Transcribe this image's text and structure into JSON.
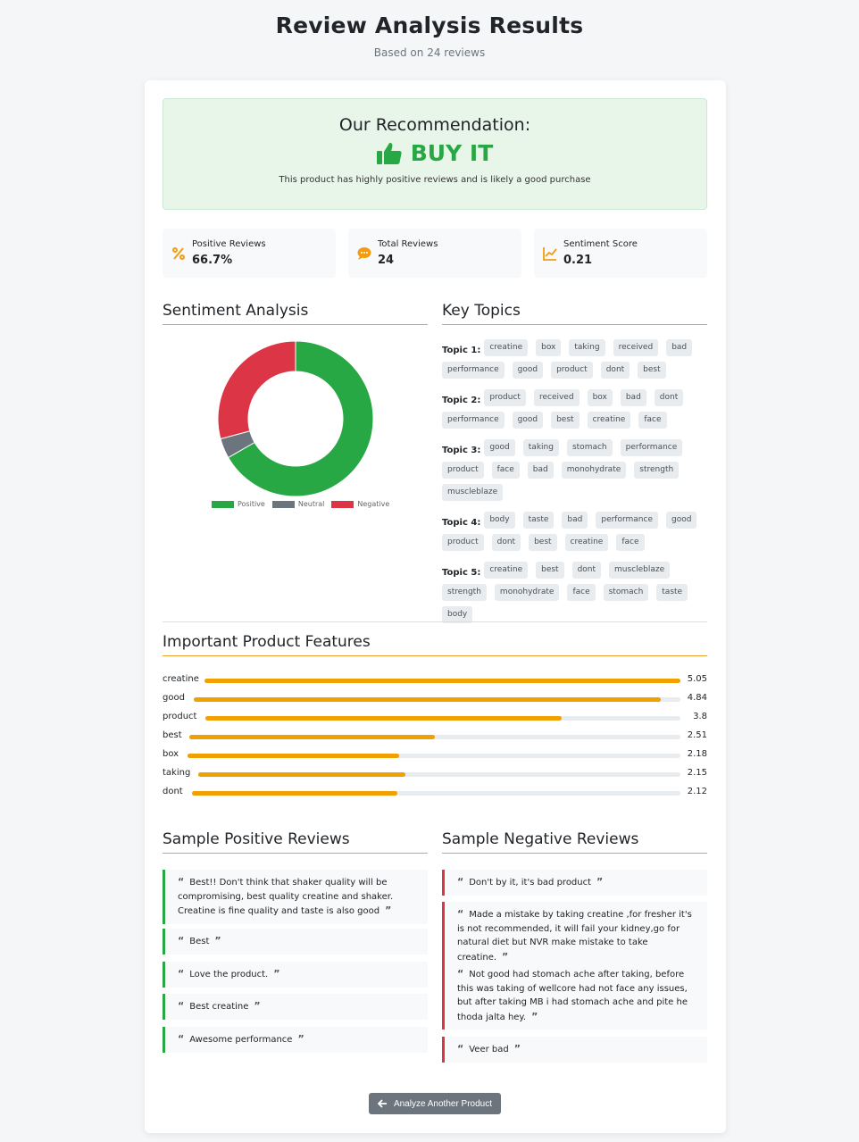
{
  "header": {
    "title": "Review Analysis Results",
    "subtitle": "Based on 24 reviews"
  },
  "recommendation": {
    "title": "Our Recommendation:",
    "verdict": "BUY IT",
    "description": "This product has highly positive reviews and is likely a good purchase"
  },
  "stats": [
    {
      "label": "Positive Reviews",
      "value": "66.7%",
      "icon": "percent-icon"
    },
    {
      "label": "Total Reviews",
      "value": "24",
      "icon": "comment-icon"
    },
    {
      "label": "Sentiment Score",
      "value": "0.21",
      "icon": "line-chart-icon"
    }
  ],
  "sentiment": {
    "title": "Sentiment Analysis",
    "legend": [
      "Positive",
      "Neutral",
      "Negative"
    ]
  },
  "chart_data": {
    "type": "pie",
    "categories": [
      "Positive",
      "Neutral",
      "Negative"
    ],
    "values": [
      16,
      1,
      7
    ],
    "colors": [
      "#28a745",
      "#6c757d",
      "#dc3545"
    ],
    "legend": "bottom"
  },
  "topics": {
    "title": "Key Topics",
    "items": [
      {
        "label": "Topic 1:",
        "tags": [
          "creatine",
          "box",
          "taking",
          "received",
          "bad",
          "performance",
          "good",
          "product",
          "dont",
          "best"
        ]
      },
      {
        "label": "Topic 2:",
        "tags": [
          "product",
          "received",
          "box",
          "bad",
          "dont",
          "performance",
          "good",
          "best",
          "creatine",
          "face"
        ]
      },
      {
        "label": "Topic 3:",
        "tags": [
          "good",
          "taking",
          "stomach",
          "performance",
          "product",
          "face",
          "bad",
          "monohydrate",
          "strength",
          "muscleblaze"
        ]
      },
      {
        "label": "Topic 4:",
        "tags": [
          "body",
          "taste",
          "bad",
          "performance",
          "good",
          "product",
          "dont",
          "best",
          "creatine",
          "face"
        ]
      },
      {
        "label": "Topic 5:",
        "tags": [
          "creatine",
          "best",
          "dont",
          "muscleblaze",
          "strength",
          "monohydrate",
          "face",
          "stomach",
          "taste",
          "body"
        ]
      }
    ]
  },
  "features": {
    "title": "Important Product Features",
    "items": [
      {
        "name": "creatine",
        "value": "5.05",
        "fraction": 1.0
      },
      {
        "name": "good",
        "value": "4.84",
        "fraction": 0.96
      },
      {
        "name": "product",
        "value": "3.8",
        "fraction": 0.75
      },
      {
        "name": "best",
        "value": "2.51",
        "fraction": 0.5
      },
      {
        "name": "box",
        "value": "2.18",
        "fraction": 0.43
      },
      {
        "name": "taking",
        "value": "2.15",
        "fraction": 0.43
      },
      {
        "name": "dont",
        "value": "2.12",
        "fraction": 0.42
      }
    ]
  },
  "positive_reviews": {
    "title": "Sample Positive Reviews",
    "items": [
      "Best!! Don't think that shaker quality will be compromising, best quality creatine and shaker. Creatine is fine quality and taste is also good",
      "Best",
      "Love the product.",
      "Best creatine",
      "Awesome performance"
    ]
  },
  "negative_reviews": {
    "title": "Sample Negative Reviews",
    "items": [
      "Don't by it, it's bad product",
      "Made a mistake by taking creatine ,for fresher it's is not recommended, it will fail your kidney,go for natural diet but NVR make mistake to take creatine.",
      "Not good had stomach ache after taking, before this was taking of wellcore had not face any issues, but after taking MB i had stomach ache and pite he thoda jalta hey.",
      "Veer bad"
    ]
  },
  "button": {
    "label": "Analyze Another Product",
    "icon": "arrow-left-icon"
  }
}
